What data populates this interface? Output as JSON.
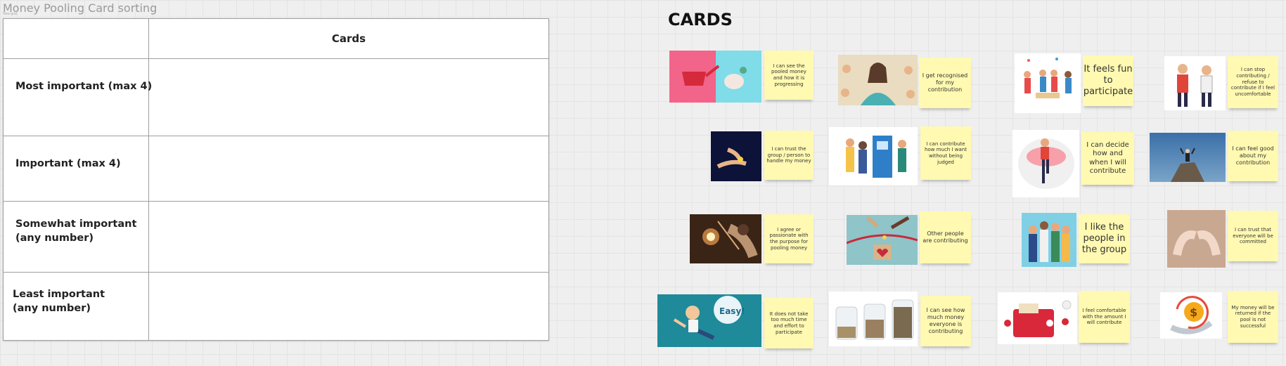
{
  "frame": {
    "title": "Money Pooling Card sorting",
    "subtitle": "New grid"
  },
  "table": {
    "header": "Cards",
    "rows": [
      "Most important (max 4)",
      "Important (max 4)",
      "Somewhat important\n(any number)",
      "Least important\n(any number)"
    ]
  },
  "section_title": "CARDS",
  "cards": [
    {
      "text": "I can see the pooled money and how it is progressing",
      "image": "watering-can-piggy-bank-illustration"
    },
    {
      "text": "I get recognised for my contribution",
      "image": "woman-applause-illustration"
    },
    {
      "text": "It feels fun to participate",
      "image": "celebrating-group-illustration"
    },
    {
      "text": "I can stop contributing / refuse to contribute if I feel uncomfortable",
      "image": "two-people-talking-illustration"
    },
    {
      "text": "I can trust the group / person to handle my money",
      "image": "hands-passing-coin-illustration"
    },
    {
      "text": "I can contribute how much I want without being judged",
      "image": "people-at-atm-illustration"
    },
    {
      "text": "I can decide how and when I will contribute",
      "image": "person-on-piggy-bank-illustration"
    },
    {
      "text": "I can feel good about my contribution",
      "image": "man-on-rock-photo"
    },
    {
      "text": "I agree or passionate with the purpose for pooling money",
      "image": "violinist-photo"
    },
    {
      "text": "Other people are contributing",
      "image": "hands-dropping-coins-in-box-illustration"
    },
    {
      "text": "I like the people in the group",
      "image": "group-of-friends-illustration"
    },
    {
      "text": "I can trust that everyone will be committed",
      "image": "pinky-promise-photo"
    },
    {
      "text": "It does not take too much time and effort to participate",
      "image": "easy-cartoon-illustration"
    },
    {
      "text": "I can see how much money everyone is contributing",
      "image": "coin-jars-photo"
    },
    {
      "text": "I feel comfortable with the amount I will contribute",
      "image": "red-wallet-illustration"
    },
    {
      "text": "My money will be returned if the pool is not successful",
      "image": "dollar-coin-refund-icon"
    }
  ]
}
